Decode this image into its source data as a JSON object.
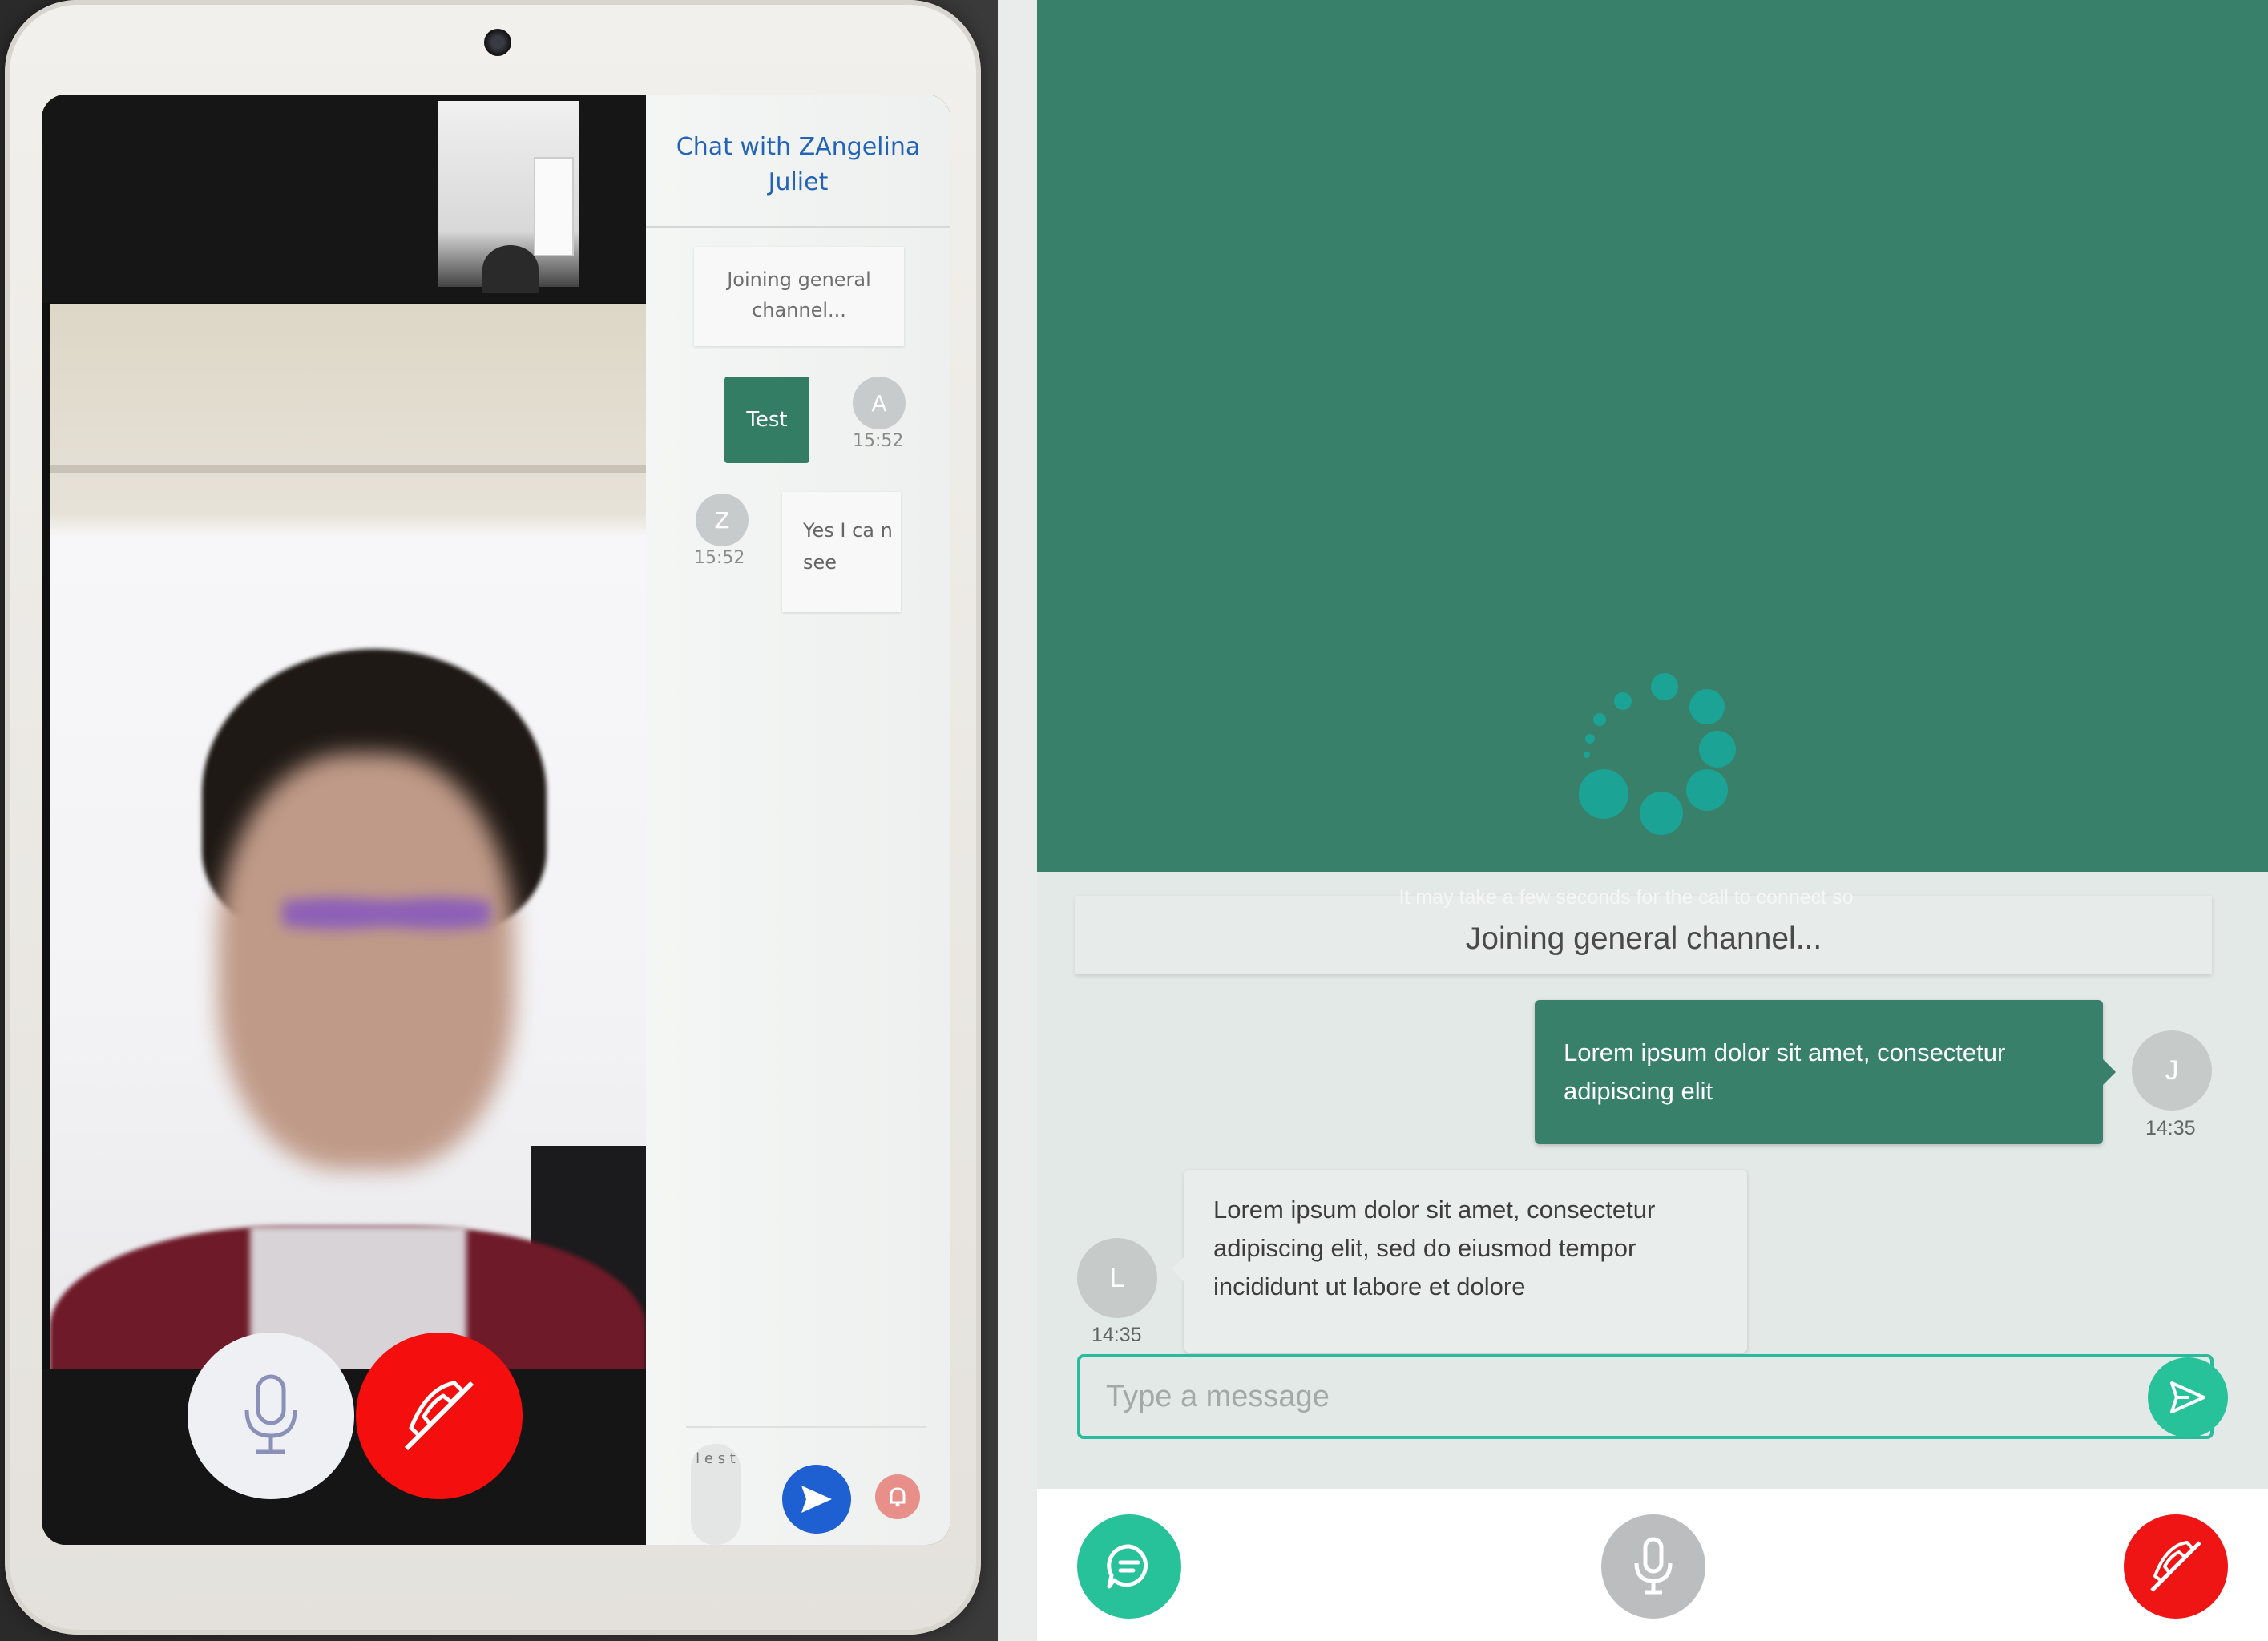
{
  "photo": {
    "chat_title": "Chat with ZAngelina Juliet",
    "joining_text": "Joining general channel...",
    "messages": [
      {
        "text": "Test",
        "avatar": "A",
        "time": "15:52",
        "side": "out"
      },
      {
        "text": "Yes I ca n see",
        "avatar": "Z",
        "time": "15:52",
        "side": "in"
      }
    ],
    "input_fragment": "l e s t",
    "icons": {
      "mic": "mic-icon",
      "hangup": "phone-hangup-icon",
      "send": "send-icon",
      "bell": "bell-icon"
    }
  },
  "app": {
    "connect_hint": "It may take a few seconds for the call to connect so",
    "joining_text": "Joining general channel...",
    "outgoing": {
      "text": "Lorem ipsum dolor sit amet, consectetur adipiscing elit",
      "avatar": "J",
      "time": "14:35"
    },
    "incoming": {
      "text": "Lorem ipsum dolor sit amet, consectetur adipiscing elit, sed do eiusmod tempor incididunt ut labore et dolore",
      "avatar": "L",
      "time": "14:35"
    },
    "input": {
      "placeholder": "Type a message",
      "value": ""
    },
    "colors": {
      "video_bg": "#38806a",
      "accent": "#27c19a",
      "hangup": "#f01515",
      "bubble_out": "#38806a",
      "spinner": "#1ba396"
    },
    "icons": {
      "send": "send-icon",
      "chat": "chat-icon",
      "mic": "mic-icon",
      "hangup": "phone-hangup-icon",
      "loading": "loading-spinner"
    }
  }
}
